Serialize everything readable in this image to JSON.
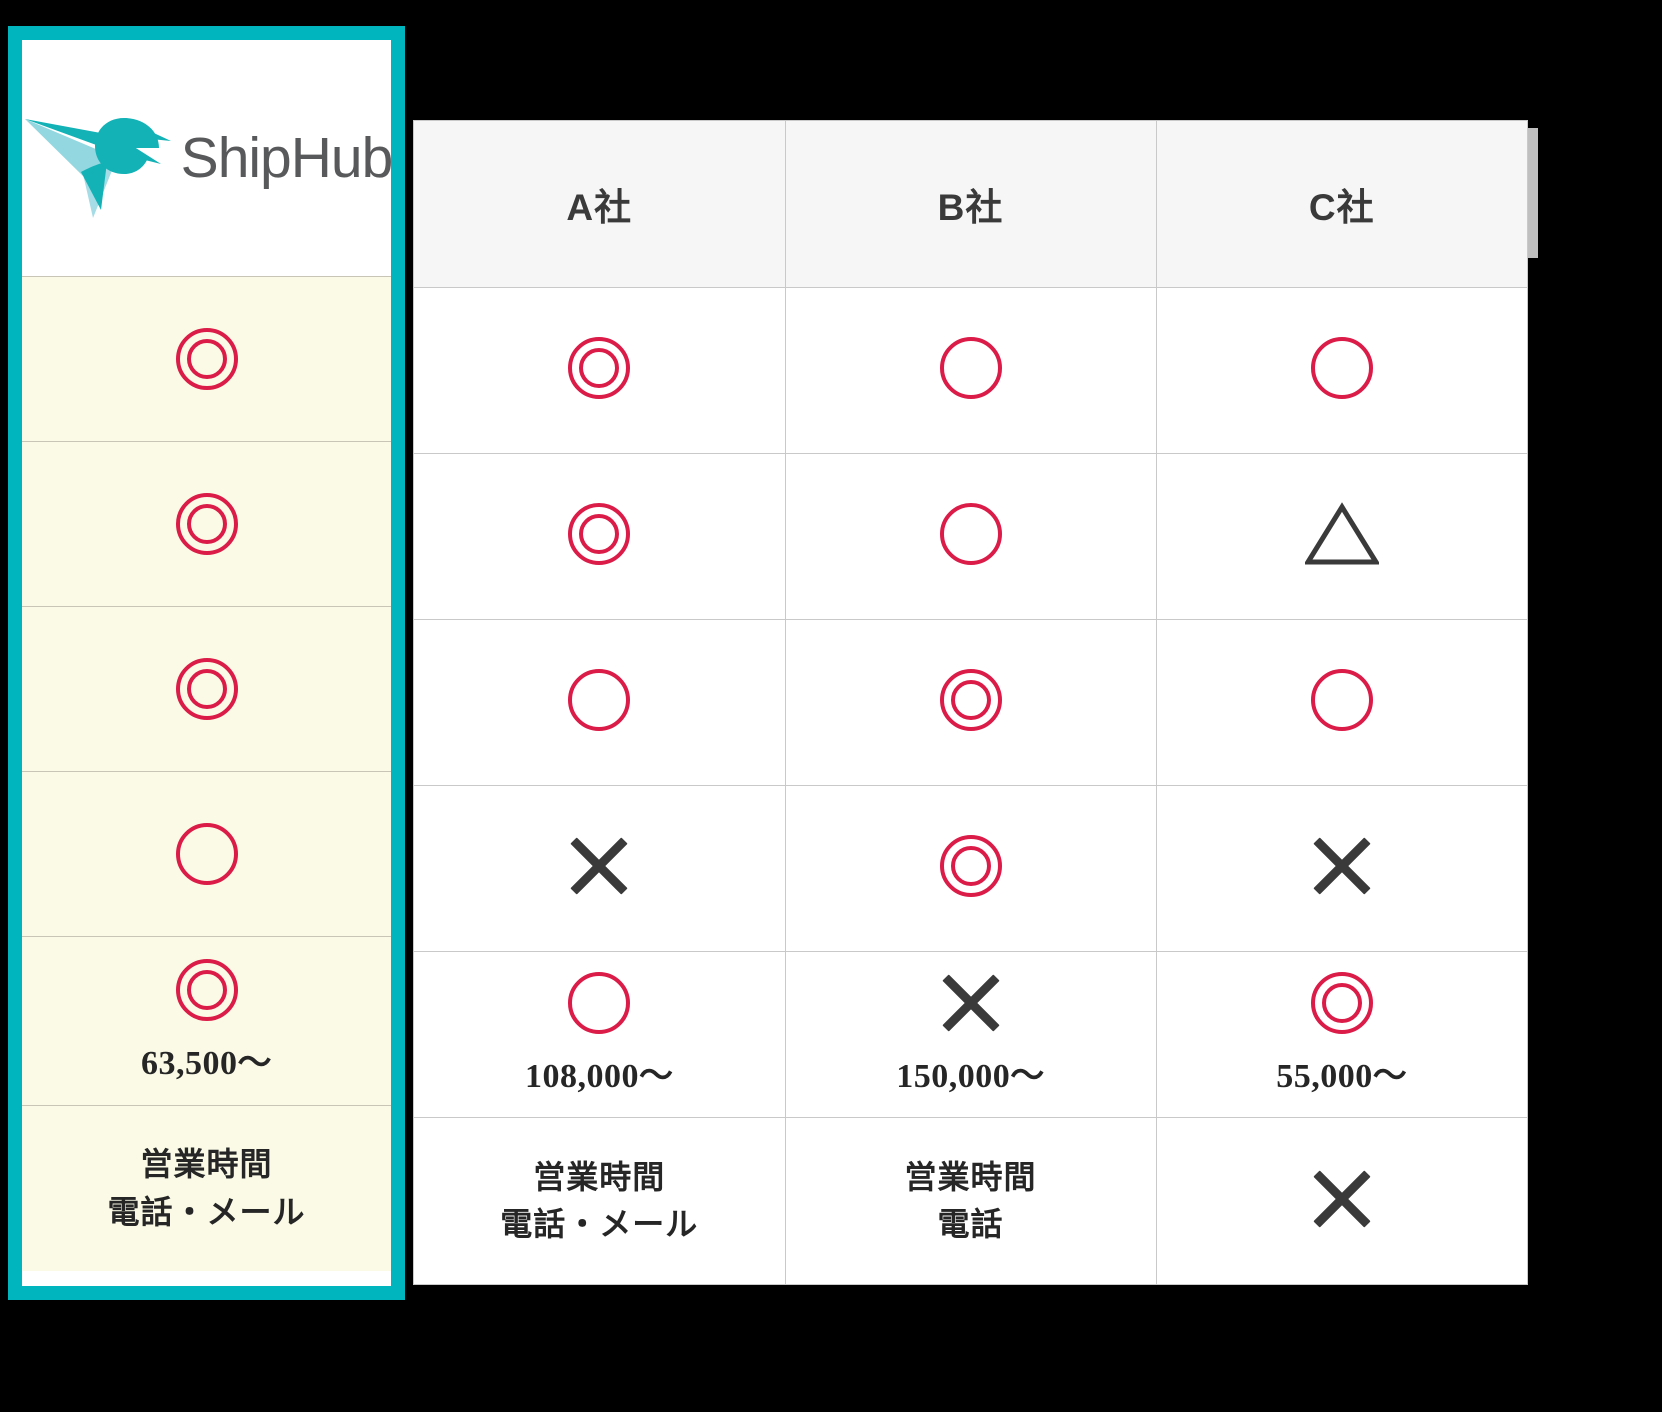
{
  "brand": {
    "name": "ShipHub",
    "logo_icon": "hummingbird-icon",
    "accent_color": "#00B5BD",
    "highlight_bg": "#FAFAE6",
    "mark_color": "#DB1B48"
  },
  "table": {
    "columns": [
      {
        "id": "shiphub",
        "label": "ShipHub",
        "highlighted": true
      },
      {
        "id": "a",
        "label": "A社",
        "highlighted": false
      },
      {
        "id": "b",
        "label": "B社",
        "highlighted": false
      },
      {
        "id": "c",
        "label": "C社",
        "highlighted": false
      }
    ],
    "rows": [
      {
        "id": "row1",
        "type": "rating",
        "cells": [
          {
            "symbol": "double-circle"
          },
          {
            "symbol": "double-circle"
          },
          {
            "symbol": "circle"
          },
          {
            "symbol": "circle"
          }
        ]
      },
      {
        "id": "row2",
        "type": "rating",
        "cells": [
          {
            "symbol": "double-circle"
          },
          {
            "symbol": "double-circle"
          },
          {
            "symbol": "circle"
          },
          {
            "symbol": "triangle"
          }
        ]
      },
      {
        "id": "row3",
        "type": "rating",
        "cells": [
          {
            "symbol": "double-circle"
          },
          {
            "symbol": "circle"
          },
          {
            "symbol": "double-circle"
          },
          {
            "symbol": "circle"
          }
        ]
      },
      {
        "id": "row4",
        "type": "rating",
        "cells": [
          {
            "symbol": "circle"
          },
          {
            "symbol": "cross"
          },
          {
            "symbol": "double-circle"
          },
          {
            "symbol": "cross"
          }
        ]
      },
      {
        "id": "row5-price",
        "type": "rating-with-price",
        "cells": [
          {
            "symbol": "double-circle",
            "text": "63,500〜"
          },
          {
            "symbol": "circle",
            "text": "108,000〜"
          },
          {
            "symbol": "cross",
            "text": "150,000〜"
          },
          {
            "symbol": "double-circle",
            "text": "55,000〜"
          }
        ]
      },
      {
        "id": "row6-support",
        "type": "text",
        "cells": [
          {
            "symbol": "none",
            "line1": "営業時間",
            "line2": "電話・メール"
          },
          {
            "symbol": "none",
            "line1": "営業時間",
            "line2": "電話・メール"
          },
          {
            "symbol": "none",
            "line1": "営業時間",
            "line2": "電話"
          },
          {
            "symbol": "cross",
            "line1": "",
            "line2": ""
          }
        ]
      }
    ]
  }
}
